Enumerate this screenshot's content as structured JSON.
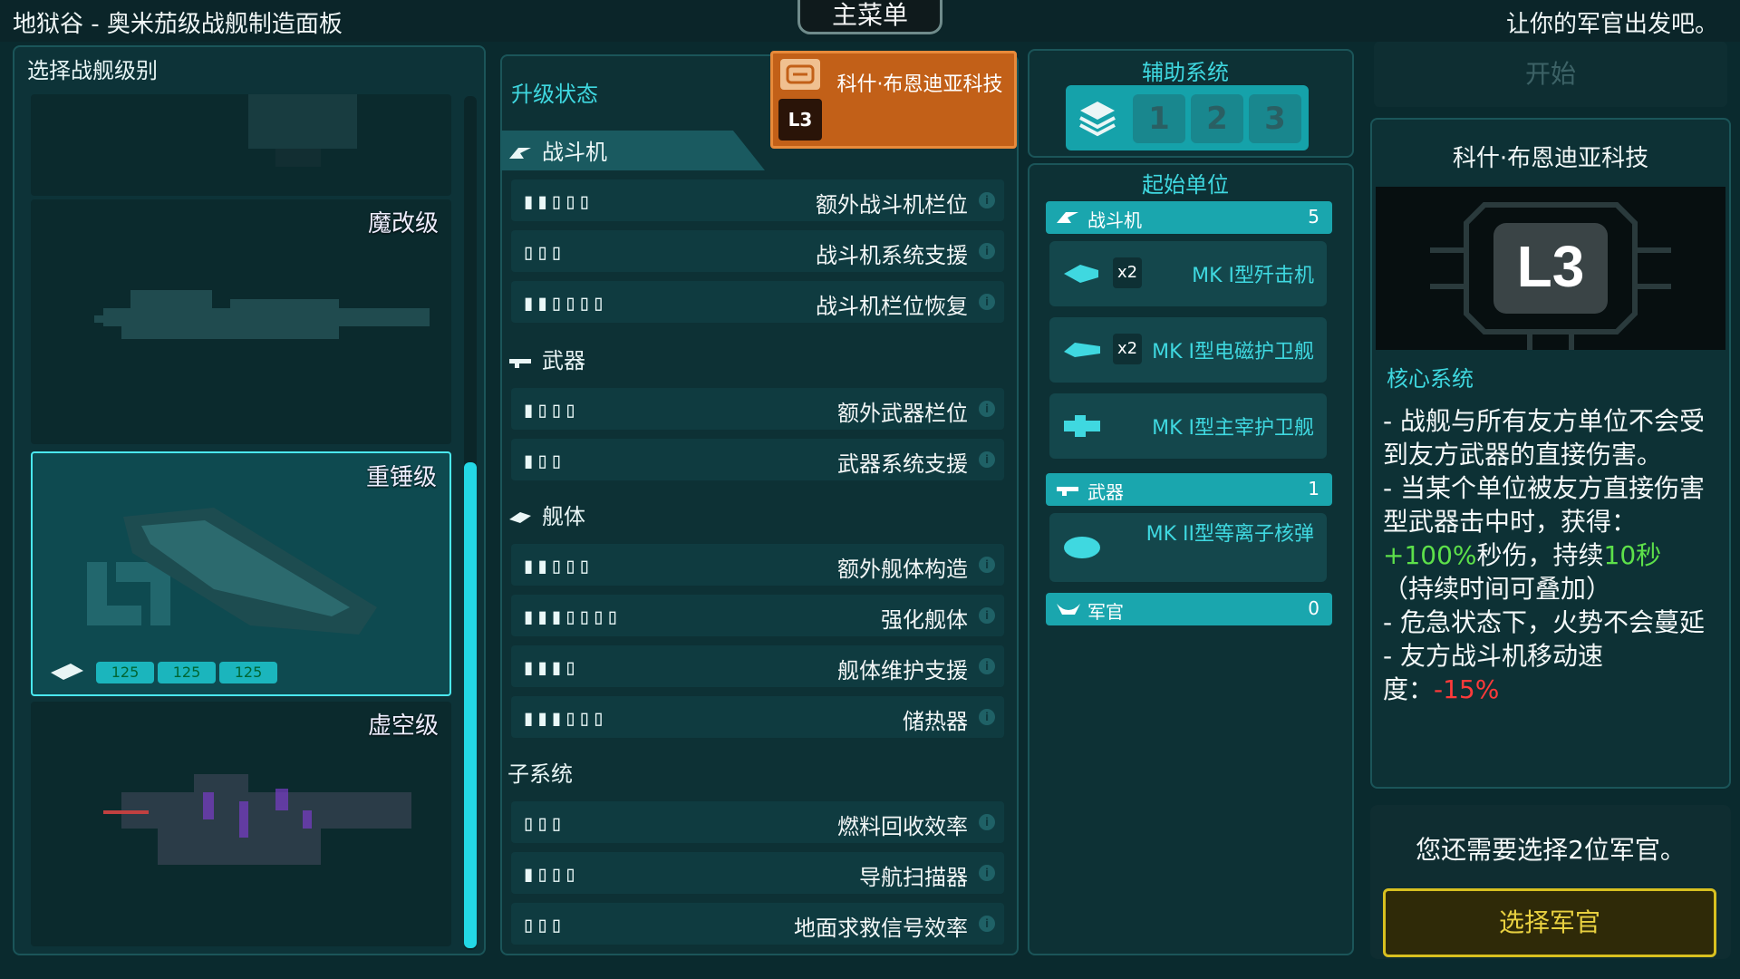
{
  "window": {
    "title": "地狱谷 - 奥米茄级战舰制造面板",
    "main_menu": "主菜单",
    "motto": "让你的军官出发吧。"
  },
  "left": {
    "header": "选择战舰级别",
    "ships": [
      {
        "name": ""
      },
      {
        "name": "魔改级"
      },
      {
        "name": "重锤级",
        "selected": true,
        "costs": [
          "125",
          "125",
          "125"
        ]
      },
      {
        "name": "虚空级"
      }
    ]
  },
  "upgrades": {
    "header": "升级状态",
    "tech_label": "科什·布恩迪亚科技",
    "categories": [
      {
        "name": "战斗机",
        "icon": "fighter-icon",
        "rows": [
          {
            "pips": "▮▮▯▯▯",
            "label": "额外战斗机栏位"
          },
          {
            "pips": "▯▯▯",
            "label": "战斗机系统支援"
          },
          {
            "pips": "▮▮▯▯▯▯",
            "label": "战斗机栏位恢复"
          }
        ]
      },
      {
        "name": "武器",
        "icon": "weapon-icon",
        "rows": [
          {
            "pips": "▮▯▯▯",
            "label": "额外武器栏位"
          },
          {
            "pips": "▮▯▯",
            "label": "武器系统支援"
          }
        ]
      },
      {
        "name": "舰体",
        "icon": "hull-icon",
        "rows": [
          {
            "pips": "▮▮▯▯▯",
            "label": "额外舰体构造"
          },
          {
            "pips": "▮▮▮▯▯▯▯",
            "label": "强化舰体"
          },
          {
            "pips": "▮▮▮▯",
            "label": "舰体维护支援"
          },
          {
            "pips": "▮▮▮▯▯▯",
            "label": "储热器"
          }
        ]
      },
      {
        "name": "子系统",
        "icon": "",
        "rows": [
          {
            "pips": "▯▯▯",
            "label": "燃料回收效率"
          },
          {
            "pips": "▮▯▯▯",
            "label": "导航扫描器"
          },
          {
            "pips": "▯▯▯",
            "label": "地面求救信号效率"
          }
        ]
      }
    ]
  },
  "aux": {
    "header": "辅助系统",
    "slots": [
      "1",
      "2",
      "3"
    ]
  },
  "start_units": {
    "header": "起始单位",
    "groups": [
      {
        "name": "战斗机",
        "count": "5",
        "items": [
          {
            "mult": "x2",
            "name": "MK I型歼击机"
          },
          {
            "mult": "x2",
            "name": "MK I型电磁护卫舰"
          },
          {
            "mult": "",
            "name": "MK I型主宰护卫舰"
          }
        ]
      },
      {
        "name": "武器",
        "count": "1",
        "items": [
          {
            "mult": "",
            "name": "MK II型等离子核弹"
          }
        ]
      },
      {
        "name": "军官",
        "count": "0",
        "items": []
      }
    ]
  },
  "right": {
    "start_button": "开始",
    "tech_title": "科什·布恩迪亚科技",
    "core_header": "核心系统",
    "desc": {
      "l1": "- 战舰与所有友方单位不会受到友方武器的直接伤害。",
      "l2a": "- 当某个单位被友方直接伤害型武器击中时，获得：",
      "l2b": "+100%",
      "l2c": "秒伤，持续",
      "l2d": "10秒",
      "l2e": "（持续时间可叠加）",
      "l3": "- 危急状态下，火势不会蔓延",
      "l4a": "- 友方战斗机移动速度：",
      "l4b": "-15%"
    },
    "officer_note": "您还需要选择2位军官。",
    "select_officer": "选择军官"
  },
  "colors": {
    "accent": "#3fd8e0",
    "orange": "#c26018",
    "gold": "#d8c020",
    "green": "#5de04a",
    "red": "#ff3a3a"
  }
}
